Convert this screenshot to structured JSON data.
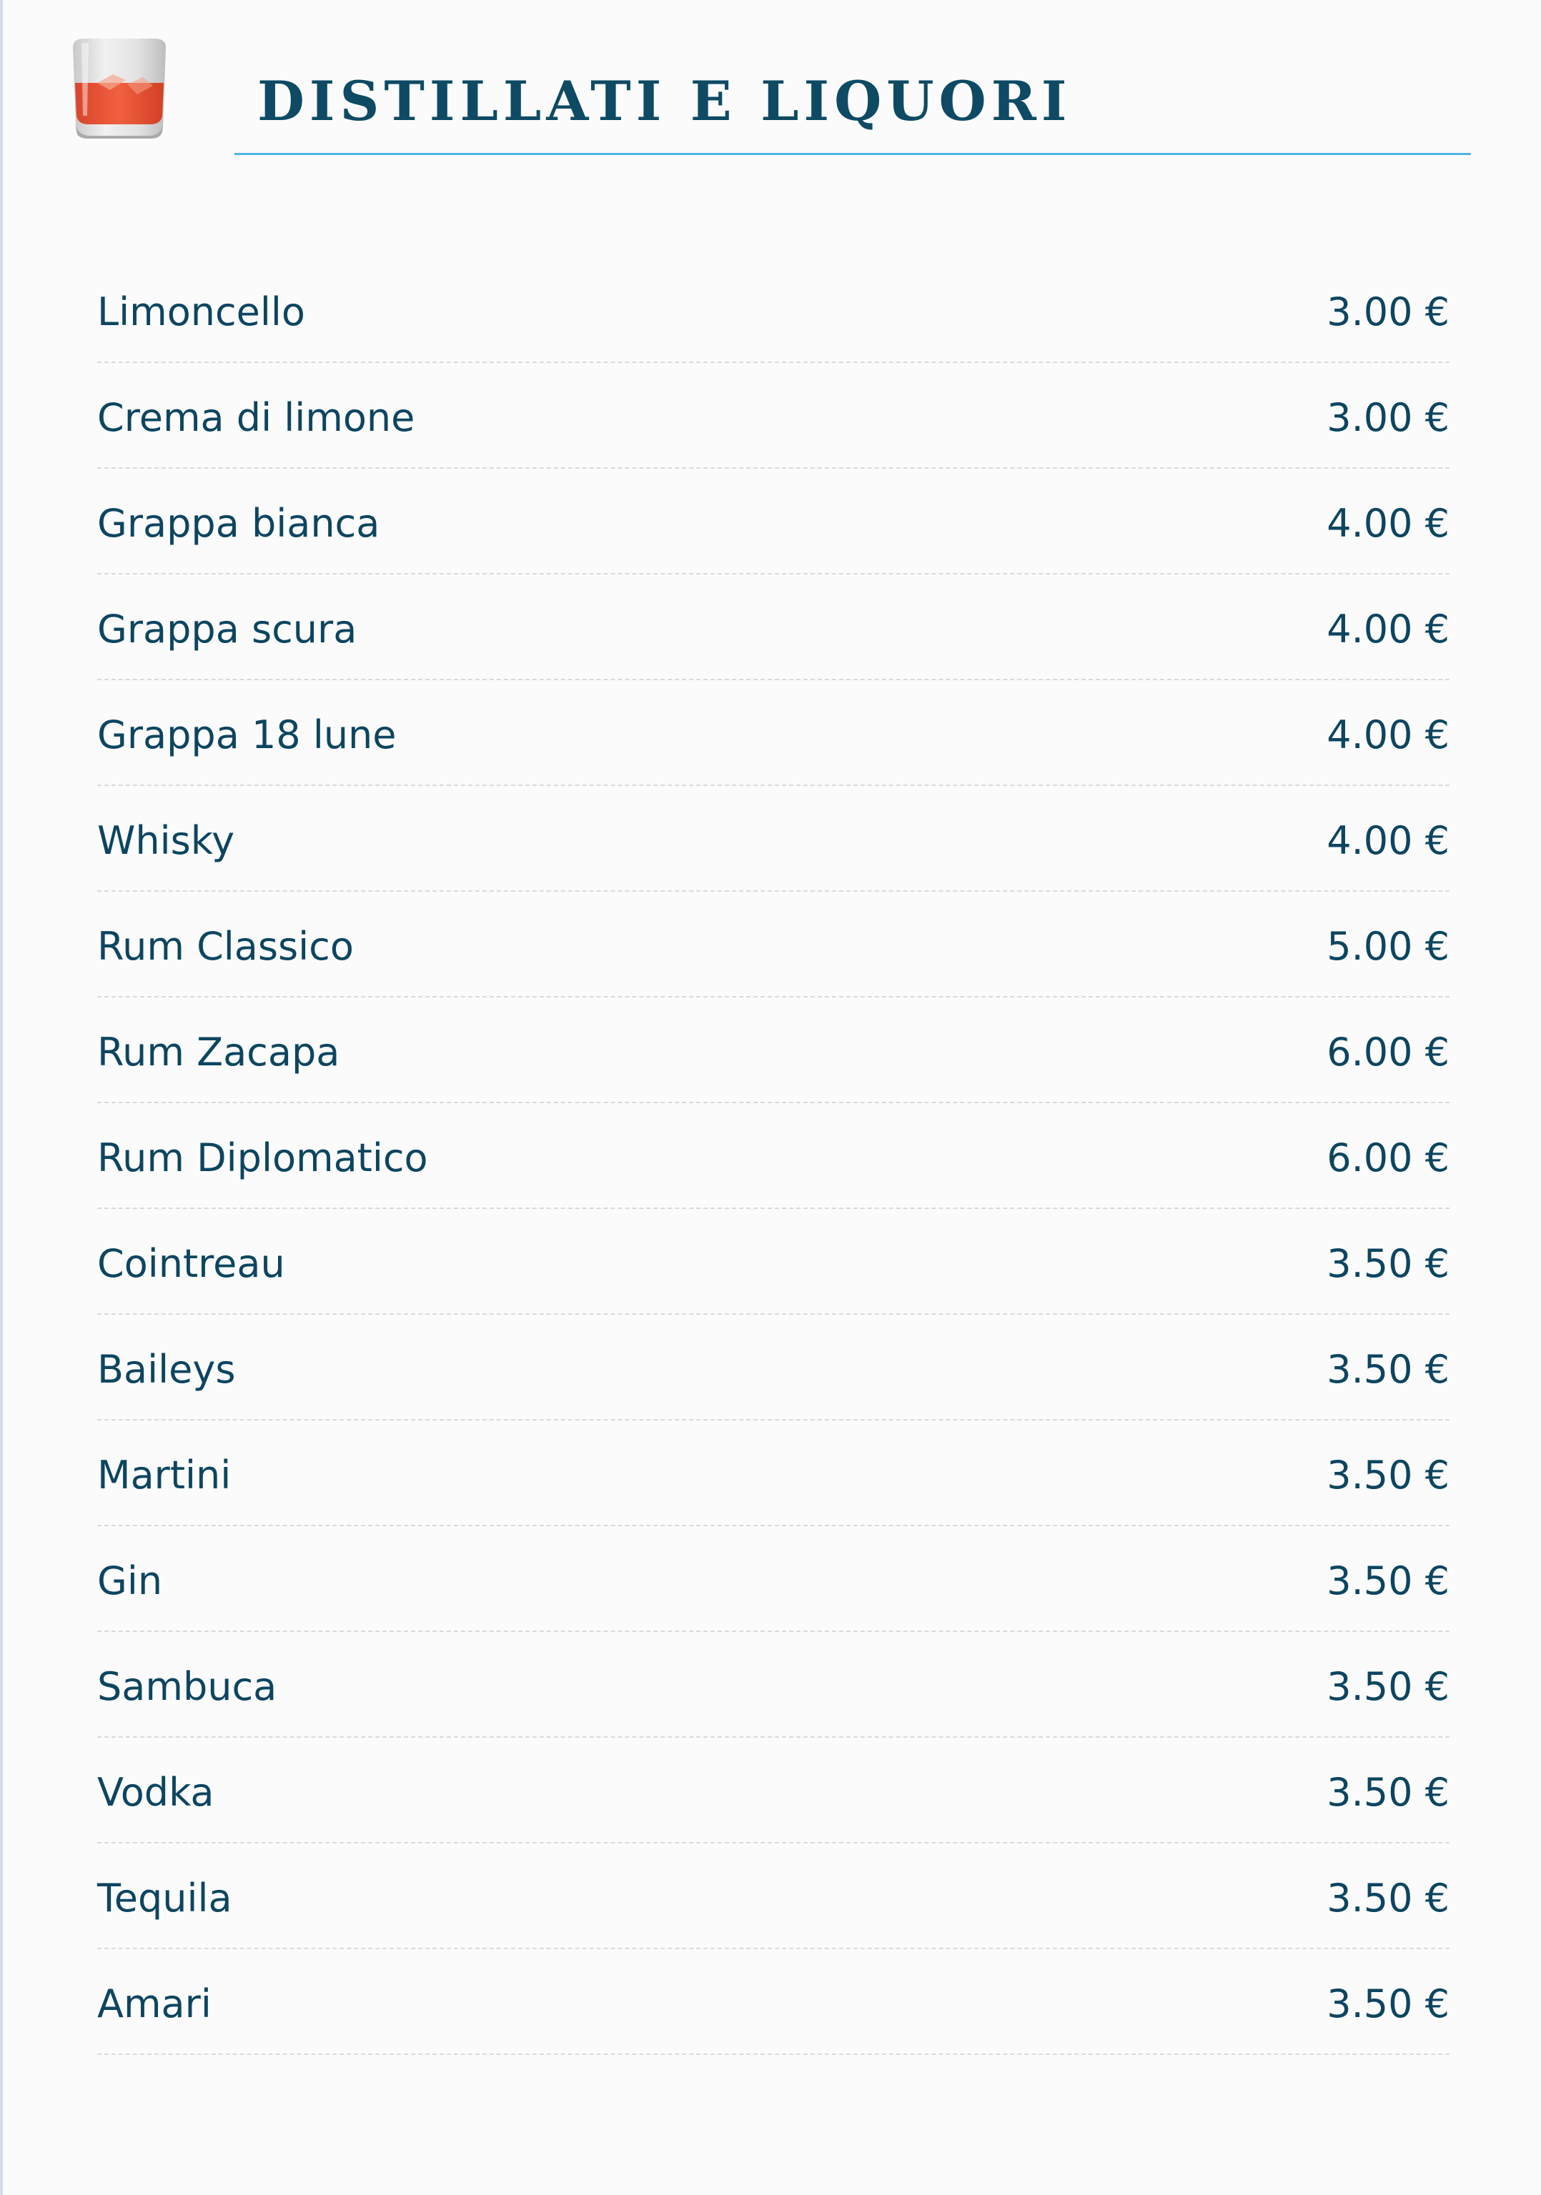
{
  "header": {
    "title": "DISTILLATI E LIQUORI",
    "icon": "liquor-glass-icon"
  },
  "colors": {
    "title": "#0e4a64",
    "text": "#0d4560",
    "accent_rule": "#4fb6e2",
    "liquor": "#e9553a"
  },
  "menu": {
    "items": [
      {
        "name": "Limoncello",
        "price": "3.00 €"
      },
      {
        "name": "Crema di limone",
        "price": "3.00 €"
      },
      {
        "name": "Grappa bianca",
        "price": "4.00 €"
      },
      {
        "name": "Grappa scura",
        "price": "4.00 €"
      },
      {
        "name": "Grappa 18 lune",
        "price": "4.00 €"
      },
      {
        "name": "Whisky",
        "price": "4.00 €"
      },
      {
        "name": "Rum Classico",
        "price": "5.00 €"
      },
      {
        "name": "Rum Zacapa",
        "price": "6.00 €"
      },
      {
        "name": "Rum Diplomatico",
        "price": "6.00 €"
      },
      {
        "name": "Cointreau",
        "price": "3.50 €"
      },
      {
        "name": "Baileys",
        "price": "3.50 €"
      },
      {
        "name": "Martini",
        "price": "3.50 €"
      },
      {
        "name": "Gin",
        "price": "3.50 €"
      },
      {
        "name": "Sambuca",
        "price": "3.50 €"
      },
      {
        "name": "Vodka",
        "price": "3.50 €"
      },
      {
        "name": "Tequila",
        "price": "3.50 €"
      },
      {
        "name": "Amari",
        "price": "3.50 €"
      }
    ]
  }
}
